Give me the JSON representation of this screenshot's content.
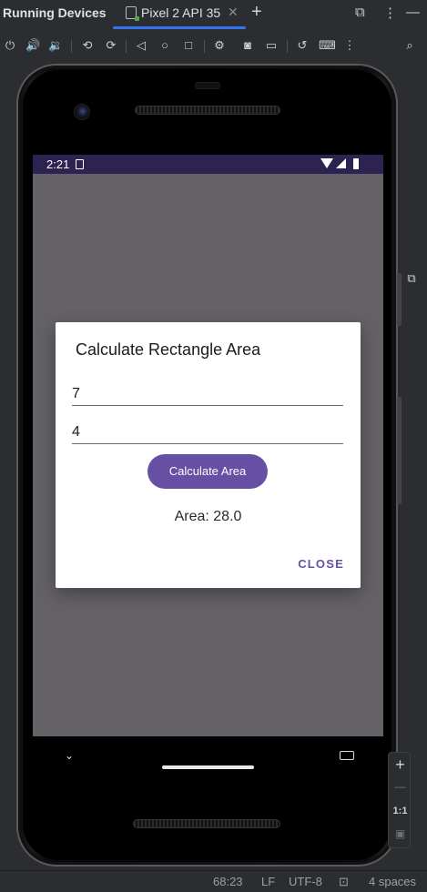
{
  "titlebar": {
    "title": "Running Devices",
    "tab_label": "Pixel 2 API 35",
    "tab_close": "✕",
    "add_tab": "+",
    "window_controls": [
      "⧉",
      "⋮",
      "—"
    ]
  },
  "toolbar": {
    "icons": [
      "power-icon",
      "volume-up-icon",
      "volume-down-icon",
      "rotate-left-icon",
      "rotate-right-icon",
      "back-icon",
      "home-icon",
      "overview-icon",
      "device-settings-icon",
      "screenshot-icon",
      "screen-record-icon",
      "reset-icon",
      "keyboard-icon",
      "more-icon"
    ]
  },
  "device": {
    "status_bar": {
      "time": "2:21"
    },
    "dialog": {
      "title": "Calculate Rectangle Area",
      "length_value": "7",
      "width_value": "4",
      "button_label": "Calculate Area",
      "result_text": "Area: 28.0",
      "close_label": "CLOSE"
    }
  },
  "zoom": {
    "in": "+",
    "out": "—",
    "one_to_one": "1:1"
  },
  "status_line": {
    "position": "68:23",
    "line_ending": "LF",
    "encoding": "UTF-8",
    "indent": "4 spaces"
  },
  "colors": {
    "accent": "#6750a4",
    "tab_underline": "#3574f0",
    "status_bar_bg": "#2d2350",
    "scrim": "#646266"
  }
}
